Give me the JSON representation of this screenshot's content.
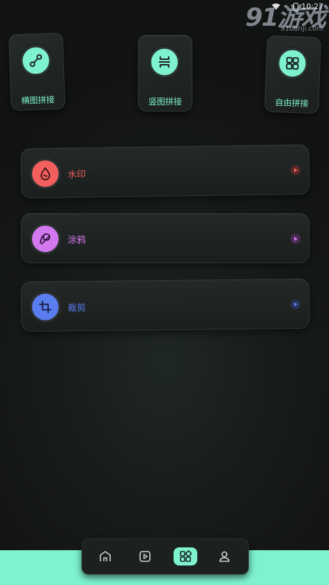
{
  "status_bar": {
    "time": "10:27",
    "wifi": "wifi-icon",
    "battery": "battery-icon"
  },
  "watermark": {
    "big": "91游戏",
    "small": "91danji.com"
  },
  "colors": {
    "accent": "#7ef2cf",
    "watermark_tool": "#f25f5c",
    "doodle_tool": "#d478f0",
    "crop_tool": "#5a7df0",
    "background": "#171b1a"
  },
  "tiles": [
    {
      "label": "横图拼接",
      "icon": "link-nodes-icon"
    },
    {
      "label": "竖图拼接",
      "icon": "vertical-stitch-icon"
    },
    {
      "label": "自由拼接",
      "icon": "grid-icon"
    }
  ],
  "tools": [
    {
      "label": "水印",
      "icon": "water-drop-icon",
      "arrow": "play-arrow-icon"
    },
    {
      "label": "涂鸦",
      "icon": "doodle-icon",
      "arrow": "play-arrow-icon"
    },
    {
      "label": "裁剪",
      "icon": "crop-icon",
      "arrow": "play-arrow-icon"
    }
  ],
  "bottom_nav": [
    {
      "icon": "home-icon"
    },
    {
      "icon": "video-icon"
    },
    {
      "icon": "apps-icon",
      "active": true
    },
    {
      "icon": "user-icon"
    }
  ]
}
